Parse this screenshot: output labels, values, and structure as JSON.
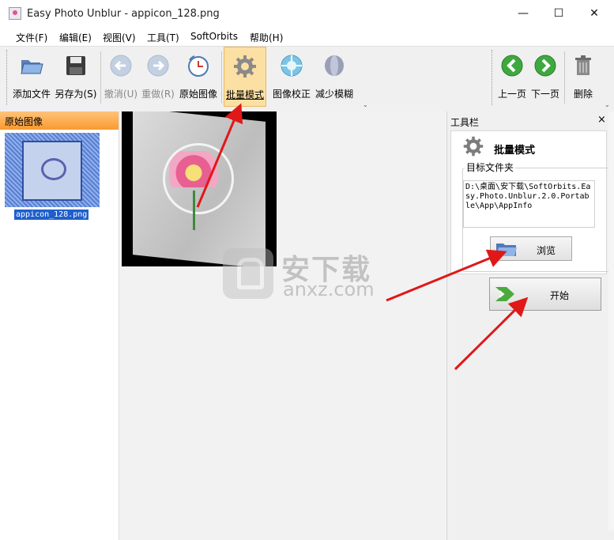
{
  "window": {
    "title": "Easy Photo Unblur - appicon_128.png",
    "minimize": "—",
    "maximize": "☐",
    "close": "✕"
  },
  "menu": [
    "文件(F)",
    "编辑(E)",
    "视图(V)",
    "工具(T)",
    "SoftOrbits",
    "帮助(H)"
  ],
  "toolbar": {
    "add_file": "添加文件",
    "save_as": "另存为(S)",
    "undo": "撤消(U)",
    "redo": "重做(R)",
    "original": "原始图像",
    "batch_mode": "批量模式",
    "correction": "图像校正",
    "reduce_blur": "减少模糊",
    "prev_page": "上一页",
    "next_page": "下一页",
    "delete": "删除",
    "overflow": "⌄"
  },
  "left_panel": {
    "header": "原始图像",
    "thumbnail_label": "appicon_128.png"
  },
  "watermark": {
    "cn": "安下载",
    "en": "anxz.com"
  },
  "right_panel": {
    "title": "工具栏",
    "close": "×",
    "batch_title": "批量模式",
    "target_folder_label": "目标文件夹",
    "target_path": "D:\\桌面\\安下载\\SoftOrbits.Easy.Photo.Unblur.2.0.Portable\\App\\AppInfo",
    "browse": "浏览",
    "start": "开始"
  },
  "colors": {
    "accent_orange": "#f99a2e",
    "annotation_red": "#e01818",
    "selection_blue": "#1f5fcc",
    "nav_green": "#3fa83f"
  }
}
